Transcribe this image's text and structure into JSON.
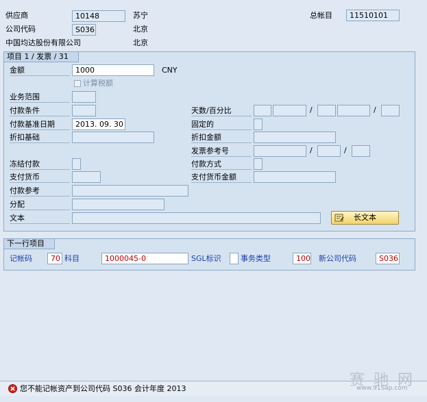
{
  "header": {
    "vendor_label": "供应商",
    "vendor_value": "10148",
    "vendor_name": "苏宁",
    "gl_label": "总帐目",
    "gl_value": "11510101",
    "company_code_label": "公司代码",
    "company_code_value": "S036",
    "company_city": "北京",
    "company_name": "中国均达股份有限公司",
    "company_name_city": "北京"
  },
  "item_group": {
    "title": "项目 1 / 发票 / 31",
    "amount_label": "金额",
    "amount_value": "1000",
    "currency": "CNY",
    "calc_tax_label": "计算税额",
    "business_area_label": "业务范围",
    "payment_terms_label": "付款条件",
    "days_percent_label": "天数/百分比",
    "baseline_date_label": "付款基准日期",
    "baseline_date_value": "2013. 09. 30",
    "fixed_label": "固定的",
    "discount_base_label": "折扣基础",
    "discount_amount_label": "折扣金额",
    "invoice_ref_label": "发票参考号",
    "payment_block_label": "冻结付款",
    "payment_method_label": "付款方式",
    "payment_currency_label": "支付货币",
    "payment_currency_amount_label": "支付货币金额",
    "payment_ref_label": "付款参考",
    "assignment_label": "分配",
    "text_label": "文本",
    "long_text_button": "长文本",
    "slash": "/"
  },
  "next_item": {
    "title": "下一行项目",
    "posting_key_label": "记帐码",
    "posting_key_value": "70",
    "account_label": "科目",
    "account_value": "1000045-0",
    "sgl_label": "SGL标识",
    "transaction_type_label": "事务类型",
    "transaction_type_value": "100",
    "new_company_label": "新公司代码",
    "new_company_value": "S036"
  },
  "status": {
    "message": "您不能记帐资产到公司代码 S036 会计年度 2013"
  },
  "watermark": {
    "text": "赛 驰 网",
    "url": "www.91Sap.com"
  }
}
